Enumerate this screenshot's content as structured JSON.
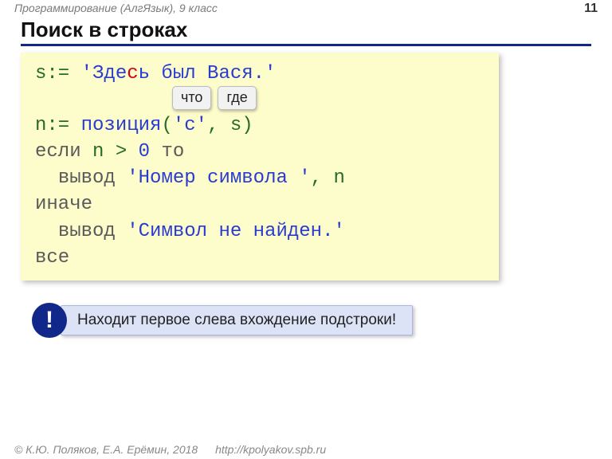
{
  "header": {
    "course": "Программирование (АлгЯзык), 9 класс",
    "page_number": "11"
  },
  "title": "Поиск в строках",
  "code": {
    "l1_a": "s:= ",
    "l1_b": "'Зде",
    "l1_c": "с",
    "l1_d": "ь был Вася.'",
    "l2_a": "n:= ",
    "l2_b": "позиция",
    "l2_c": "(",
    "l2_d": "'с'",
    "l2_e": ", s)",
    "l3_a": "если",
    "l3_b": " n > ",
    "l3_c": "0",
    "l3_d": " ",
    "l3_e": "то",
    "l4_a": "  ",
    "l4_b": "вывод",
    "l4_c": " ",
    "l4_d": "'Номер символа '",
    "l4_e": ", n",
    "l5": "иначе",
    "l6_a": "  ",
    "l6_b": "вывод",
    "l6_c": " ",
    "l6_d": "'Символ не найден.'",
    "l7": "все"
  },
  "tags": {
    "what": "что",
    "where": "где"
  },
  "note": {
    "icon": "!",
    "text": "Находит первое слева вхождение подстроки!"
  },
  "footer": {
    "copyright": "© К.Ю. Поляков, Е.А. Ерёмин, 2018",
    "url": "http://kpolyakov.spb.ru"
  }
}
